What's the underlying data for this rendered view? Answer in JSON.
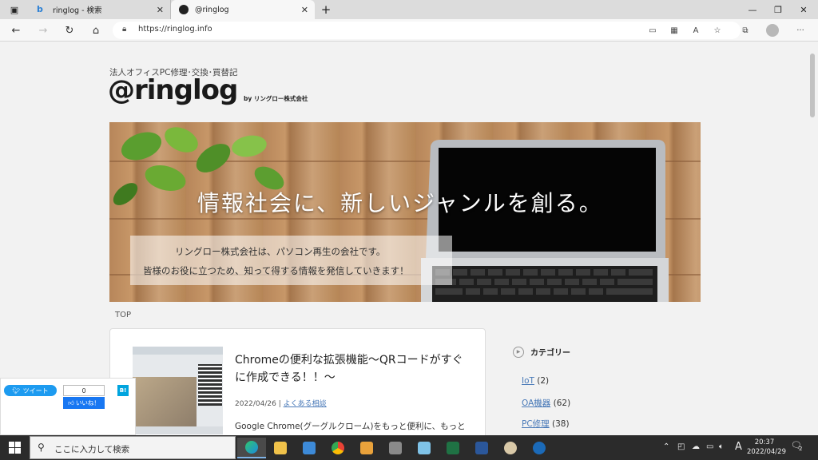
{
  "browser": {
    "tabs": [
      {
        "title": "ringlog - 検索"
      },
      {
        "title": "@ringlog"
      }
    ],
    "new_tab": "+",
    "url": "https://ringlog.info"
  },
  "site": {
    "tagline": "法人オフィスPC修理･交換･買替記",
    "logo": "@ringlog",
    "byline": "by リングロー株式会社",
    "hero_title": "情報社会に、新しいジャンルを創る。",
    "hero_line1": "リングロー株式会社は、パソコン再生の会社です。",
    "hero_line2": "皆様のお役に立つため、知って得する情報を発信していきます！",
    "breadcrumb": "TOP"
  },
  "article": {
    "title": "Chromeの便利な拡張機能～QRコードがすぐに作成できる！！～",
    "date": "2022/04/26",
    "separator": " | ",
    "category": "よくある相談",
    "excerpt": "Google Chrome(グーグルクローム)をもっと便利に、もっと"
  },
  "sidebar": {
    "heading": "カテゴリー",
    "categories": [
      {
        "name": "IoT",
        "count": "(2)"
      },
      {
        "name": "OA機器",
        "count": "(62)"
      },
      {
        "name": "PC修理",
        "count": "(38)"
      }
    ]
  },
  "share": {
    "tweet": "ツイート",
    "like_count": "0",
    "like": "いいね！",
    "hatena": "B!"
  },
  "taskbar": {
    "search_placeholder": "ここに入力して検索",
    "ime": "A",
    "time": "20:37",
    "date": "2022/04/29",
    "notifications": "2"
  }
}
